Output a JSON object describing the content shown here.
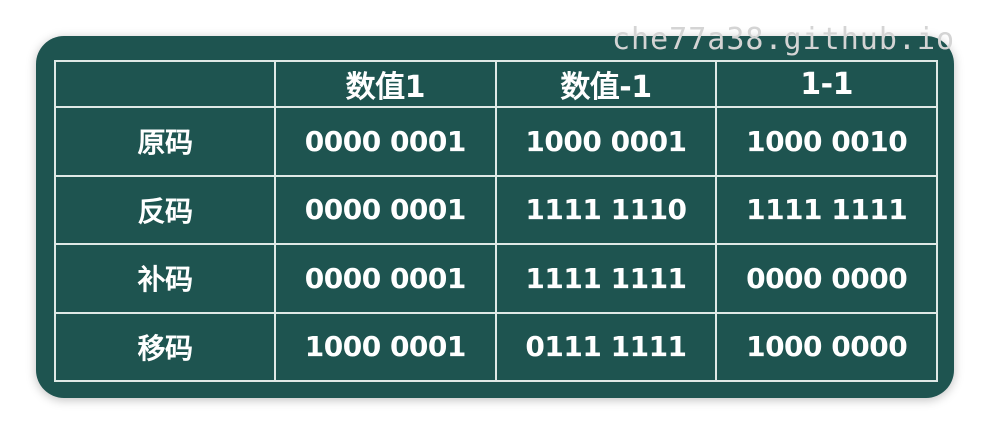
{
  "watermark": "che77a38.github.io",
  "table": {
    "headers": [
      "",
      "数值1",
      "数值-1",
      "1-1"
    ],
    "rows": [
      {
        "label": "原码",
        "cells": [
          "0000 0001",
          "1000 0001",
          "1000 0010"
        ]
      },
      {
        "label": "反码",
        "cells": [
          "0000 0001",
          "1111 1110",
          "1111 1111"
        ]
      },
      {
        "label": "补码",
        "cells": [
          "0000 0001",
          "1111 1111",
          "0000 0000"
        ]
      },
      {
        "label": "移码",
        "cells": [
          "1000 0001",
          "0111 1111",
          "1000 0000"
        ]
      }
    ]
  },
  "colors": {
    "board_background": "#1e5450",
    "grid_line": "#dfe9e6",
    "text": "#ffffff"
  }
}
